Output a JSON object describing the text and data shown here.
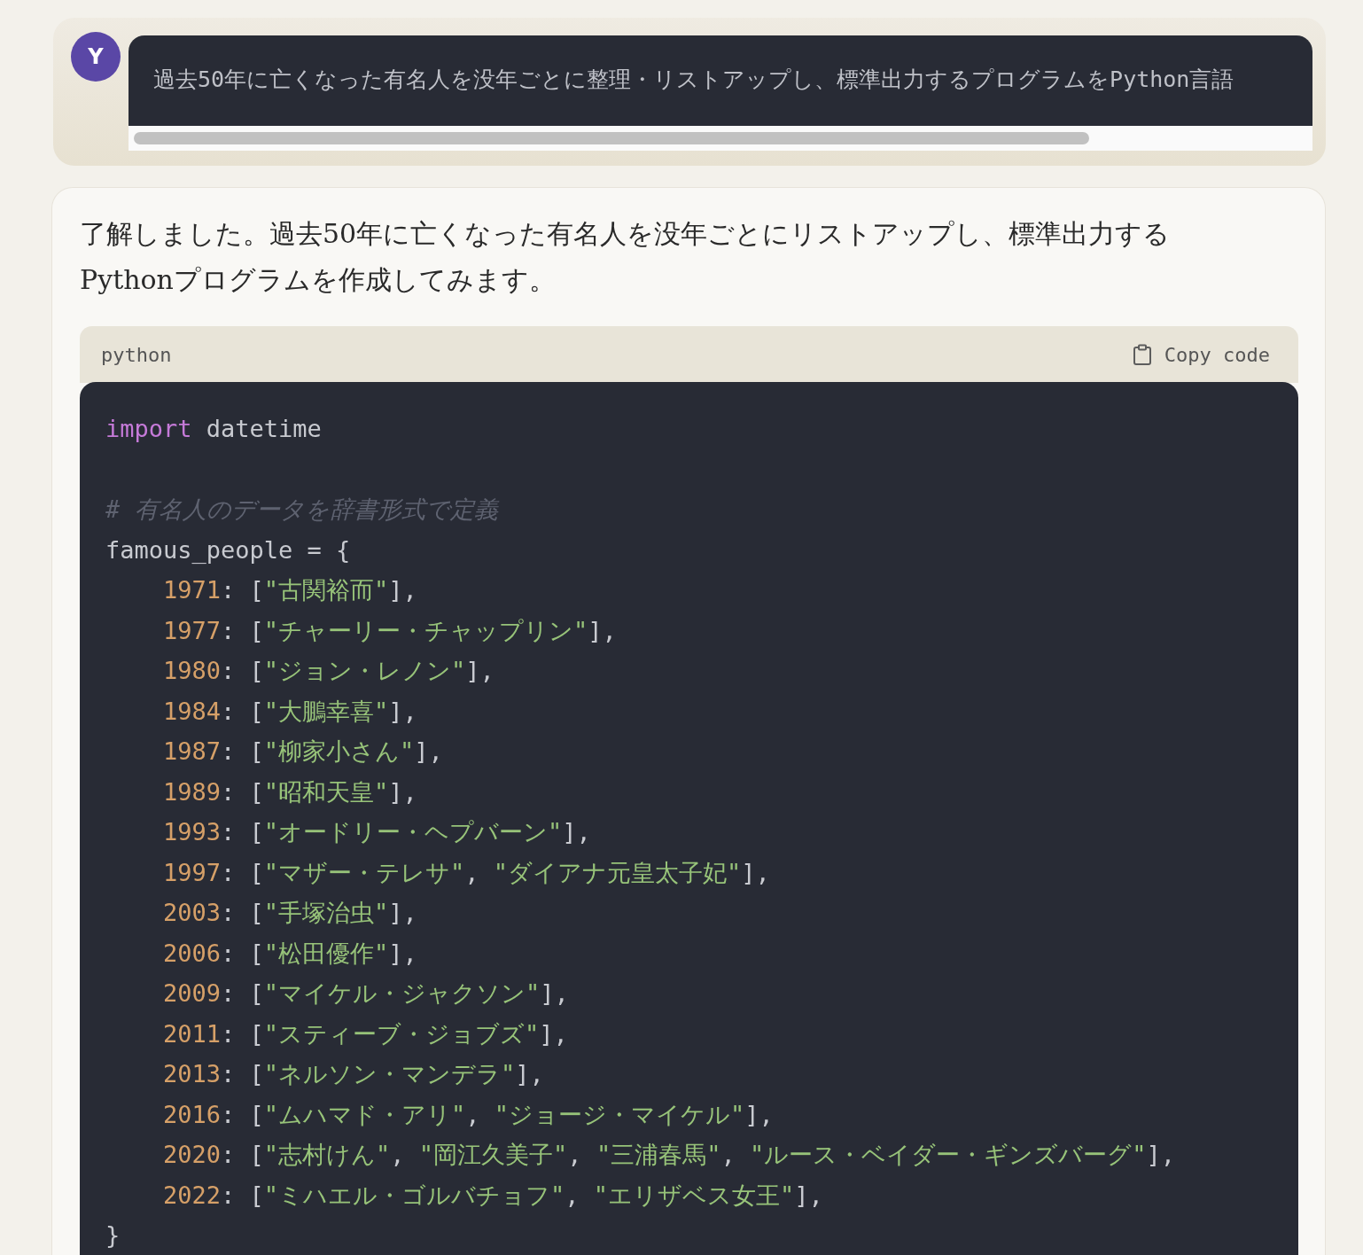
{
  "user_message": {
    "avatar_letter": "Y",
    "text": "過去50年に亡くなった有名人を没年ごとに整理・リストアップし、標準出力するプログラムをPython言語"
  },
  "assistant_message": {
    "text": "了解しました。過去50年に亡くなった有名人を没年ごとにリストアップし、標準出力するPythonプログラムを作成してみます。",
    "code_block": {
      "language": "python",
      "copy_label": "Copy code",
      "lines": [
        {
          "kind": "code",
          "indented": false,
          "tokens": [
            {
              "kind": "keyword",
              "text": "import"
            },
            {
              "kind": "plain",
              "text": " datetime"
            }
          ]
        },
        {
          "kind": "blank"
        },
        {
          "kind": "code",
          "indented": false,
          "tokens": [
            {
              "kind": "comment",
              "text": "# 有名人のデータを辞書形式で定義"
            }
          ]
        },
        {
          "kind": "code",
          "indented": false,
          "tokens": [
            {
              "kind": "plain",
              "text": "famous_people = {"
            }
          ]
        },
        {
          "kind": "code",
          "indented": true,
          "tokens": [
            {
              "kind": "number",
              "text": "1971"
            },
            {
              "kind": "plain",
              "text": ": ["
            },
            {
              "kind": "string",
              "text": "\"古関裕而\""
            },
            {
              "kind": "plain",
              "text": "],"
            }
          ]
        },
        {
          "kind": "code",
          "indented": true,
          "tokens": [
            {
              "kind": "number",
              "text": "1977"
            },
            {
              "kind": "plain",
              "text": ": ["
            },
            {
              "kind": "string",
              "text": "\"チャーリー・チャップリン\""
            },
            {
              "kind": "plain",
              "text": "],"
            }
          ]
        },
        {
          "kind": "code",
          "indented": true,
          "tokens": [
            {
              "kind": "number",
              "text": "1980"
            },
            {
              "kind": "plain",
              "text": ": ["
            },
            {
              "kind": "string",
              "text": "\"ジョン・レノン\""
            },
            {
              "kind": "plain",
              "text": "],"
            }
          ]
        },
        {
          "kind": "code",
          "indented": true,
          "tokens": [
            {
              "kind": "number",
              "text": "1984"
            },
            {
              "kind": "plain",
              "text": ": ["
            },
            {
              "kind": "string",
              "text": "\"大鵬幸喜\""
            },
            {
              "kind": "plain",
              "text": "],"
            }
          ]
        },
        {
          "kind": "code",
          "indented": true,
          "tokens": [
            {
              "kind": "number",
              "text": "1987"
            },
            {
              "kind": "plain",
              "text": ": ["
            },
            {
              "kind": "string",
              "text": "\"柳家小さん\""
            },
            {
              "kind": "plain",
              "text": "],"
            }
          ]
        },
        {
          "kind": "code",
          "indented": true,
          "tokens": [
            {
              "kind": "number",
              "text": "1989"
            },
            {
              "kind": "plain",
              "text": ": ["
            },
            {
              "kind": "string",
              "text": "\"昭和天皇\""
            },
            {
              "kind": "plain",
              "text": "],"
            }
          ]
        },
        {
          "kind": "code",
          "indented": true,
          "tokens": [
            {
              "kind": "number",
              "text": "1993"
            },
            {
              "kind": "plain",
              "text": ": ["
            },
            {
              "kind": "string",
              "text": "\"オードリー・ヘプバーン\""
            },
            {
              "kind": "plain",
              "text": "],"
            }
          ]
        },
        {
          "kind": "code",
          "indented": true,
          "tokens": [
            {
              "kind": "number",
              "text": "1997"
            },
            {
              "kind": "plain",
              "text": ": ["
            },
            {
              "kind": "string",
              "text": "\"マザー・テレサ\""
            },
            {
              "kind": "plain",
              "text": ", "
            },
            {
              "kind": "string",
              "text": "\"ダイアナ元皇太子妃\""
            },
            {
              "kind": "plain",
              "text": "],"
            }
          ]
        },
        {
          "kind": "code",
          "indented": true,
          "tokens": [
            {
              "kind": "number",
              "text": "2003"
            },
            {
              "kind": "plain",
              "text": ": ["
            },
            {
              "kind": "string",
              "text": "\"手塚治虫\""
            },
            {
              "kind": "plain",
              "text": "],"
            }
          ]
        },
        {
          "kind": "code",
          "indented": true,
          "tokens": [
            {
              "kind": "number",
              "text": "2006"
            },
            {
              "kind": "plain",
              "text": ": ["
            },
            {
              "kind": "string",
              "text": "\"松田優作\""
            },
            {
              "kind": "plain",
              "text": "],"
            }
          ]
        },
        {
          "kind": "code",
          "indented": true,
          "tokens": [
            {
              "kind": "number",
              "text": "2009"
            },
            {
              "kind": "plain",
              "text": ": ["
            },
            {
              "kind": "string",
              "text": "\"マイケル・ジャクソン\""
            },
            {
              "kind": "plain",
              "text": "],"
            }
          ]
        },
        {
          "kind": "code",
          "indented": true,
          "tokens": [
            {
              "kind": "number",
              "text": "2011"
            },
            {
              "kind": "plain",
              "text": ": ["
            },
            {
              "kind": "string",
              "text": "\"スティーブ・ジョブズ\""
            },
            {
              "kind": "plain",
              "text": "],"
            }
          ]
        },
        {
          "kind": "code",
          "indented": true,
          "tokens": [
            {
              "kind": "number",
              "text": "2013"
            },
            {
              "kind": "plain",
              "text": ": ["
            },
            {
              "kind": "string",
              "text": "\"ネルソン・マンデラ\""
            },
            {
              "kind": "plain",
              "text": "],"
            }
          ]
        },
        {
          "kind": "code",
          "indented": true,
          "tokens": [
            {
              "kind": "number",
              "text": "2016"
            },
            {
              "kind": "plain",
              "text": ": ["
            },
            {
              "kind": "string",
              "text": "\"ムハマド・アリ\""
            },
            {
              "kind": "plain",
              "text": ", "
            },
            {
              "kind": "string",
              "text": "\"ジョージ・マイケル\""
            },
            {
              "kind": "plain",
              "text": "],"
            }
          ]
        },
        {
          "kind": "code",
          "indented": true,
          "tokens": [
            {
              "kind": "number",
              "text": "2020"
            },
            {
              "kind": "plain",
              "text": ": ["
            },
            {
              "kind": "string",
              "text": "\"志村けん\""
            },
            {
              "kind": "plain",
              "text": ", "
            },
            {
              "kind": "string",
              "text": "\"岡江久美子\""
            },
            {
              "kind": "plain",
              "text": ", "
            },
            {
              "kind": "string",
              "text": "\"三浦春馬\""
            },
            {
              "kind": "plain",
              "text": ", "
            },
            {
              "kind": "string",
              "text": "\"ルース・ベイダー・ギンズバーグ\""
            },
            {
              "kind": "plain",
              "text": "],"
            }
          ]
        },
        {
          "kind": "code",
          "indented": true,
          "tokens": [
            {
              "kind": "number",
              "text": "2022"
            },
            {
              "kind": "plain",
              "text": ": ["
            },
            {
              "kind": "string",
              "text": "\"ミハエル・ゴルバチョフ\""
            },
            {
              "kind": "plain",
              "text": ", "
            },
            {
              "kind": "string",
              "text": "\"エリザベス女王\""
            },
            {
              "kind": "plain",
              "text": "],"
            }
          ]
        },
        {
          "kind": "code",
          "indented": false,
          "tokens": [
            {
              "kind": "plain",
              "text": "}"
            }
          ]
        }
      ]
    }
  }
}
